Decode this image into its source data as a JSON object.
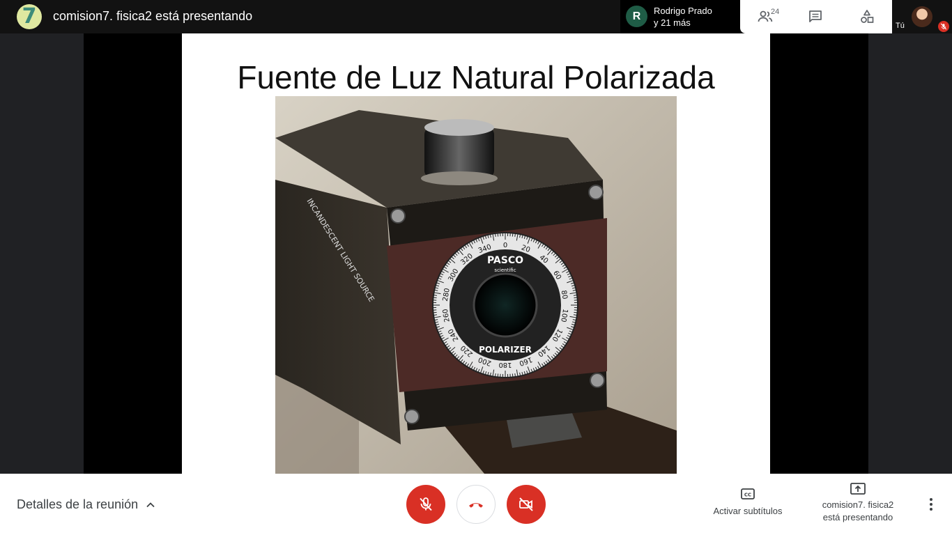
{
  "header": {
    "presenting_title": "comision7. fisica2 está presentando",
    "tile_avatar_letter": "R",
    "tile_name_line1": "Rodrigo Prado",
    "tile_name_line2": "y 21 más",
    "participants_count": "24",
    "self_label": "Tú",
    "logo_text": "7"
  },
  "slide": {
    "title": "Fuente de Luz Natural Polarizada",
    "photo_brand": "PASCO",
    "photo_brand_sub": "scientific",
    "photo_dial_label": "POLARIZER",
    "photo_side_label": "INCANDESCENT LIGHT SOURCE",
    "dial_numbers": [
      "0",
      "20",
      "40",
      "60",
      "80",
      "100",
      "120",
      "140",
      "160",
      "180",
      "200",
      "220",
      "240",
      "260",
      "280",
      "300",
      "320",
      "340"
    ]
  },
  "bottom": {
    "meeting_details": "Detalles de la reunión",
    "captions_label": "Activar subtítulos",
    "presenting_line1": "comision7. fisica2",
    "presenting_line2": "está presentando"
  },
  "colors": {
    "accent_red": "#d93025",
    "topbar_bg": "#121212",
    "tile_avatar": "#1f5c46"
  }
}
